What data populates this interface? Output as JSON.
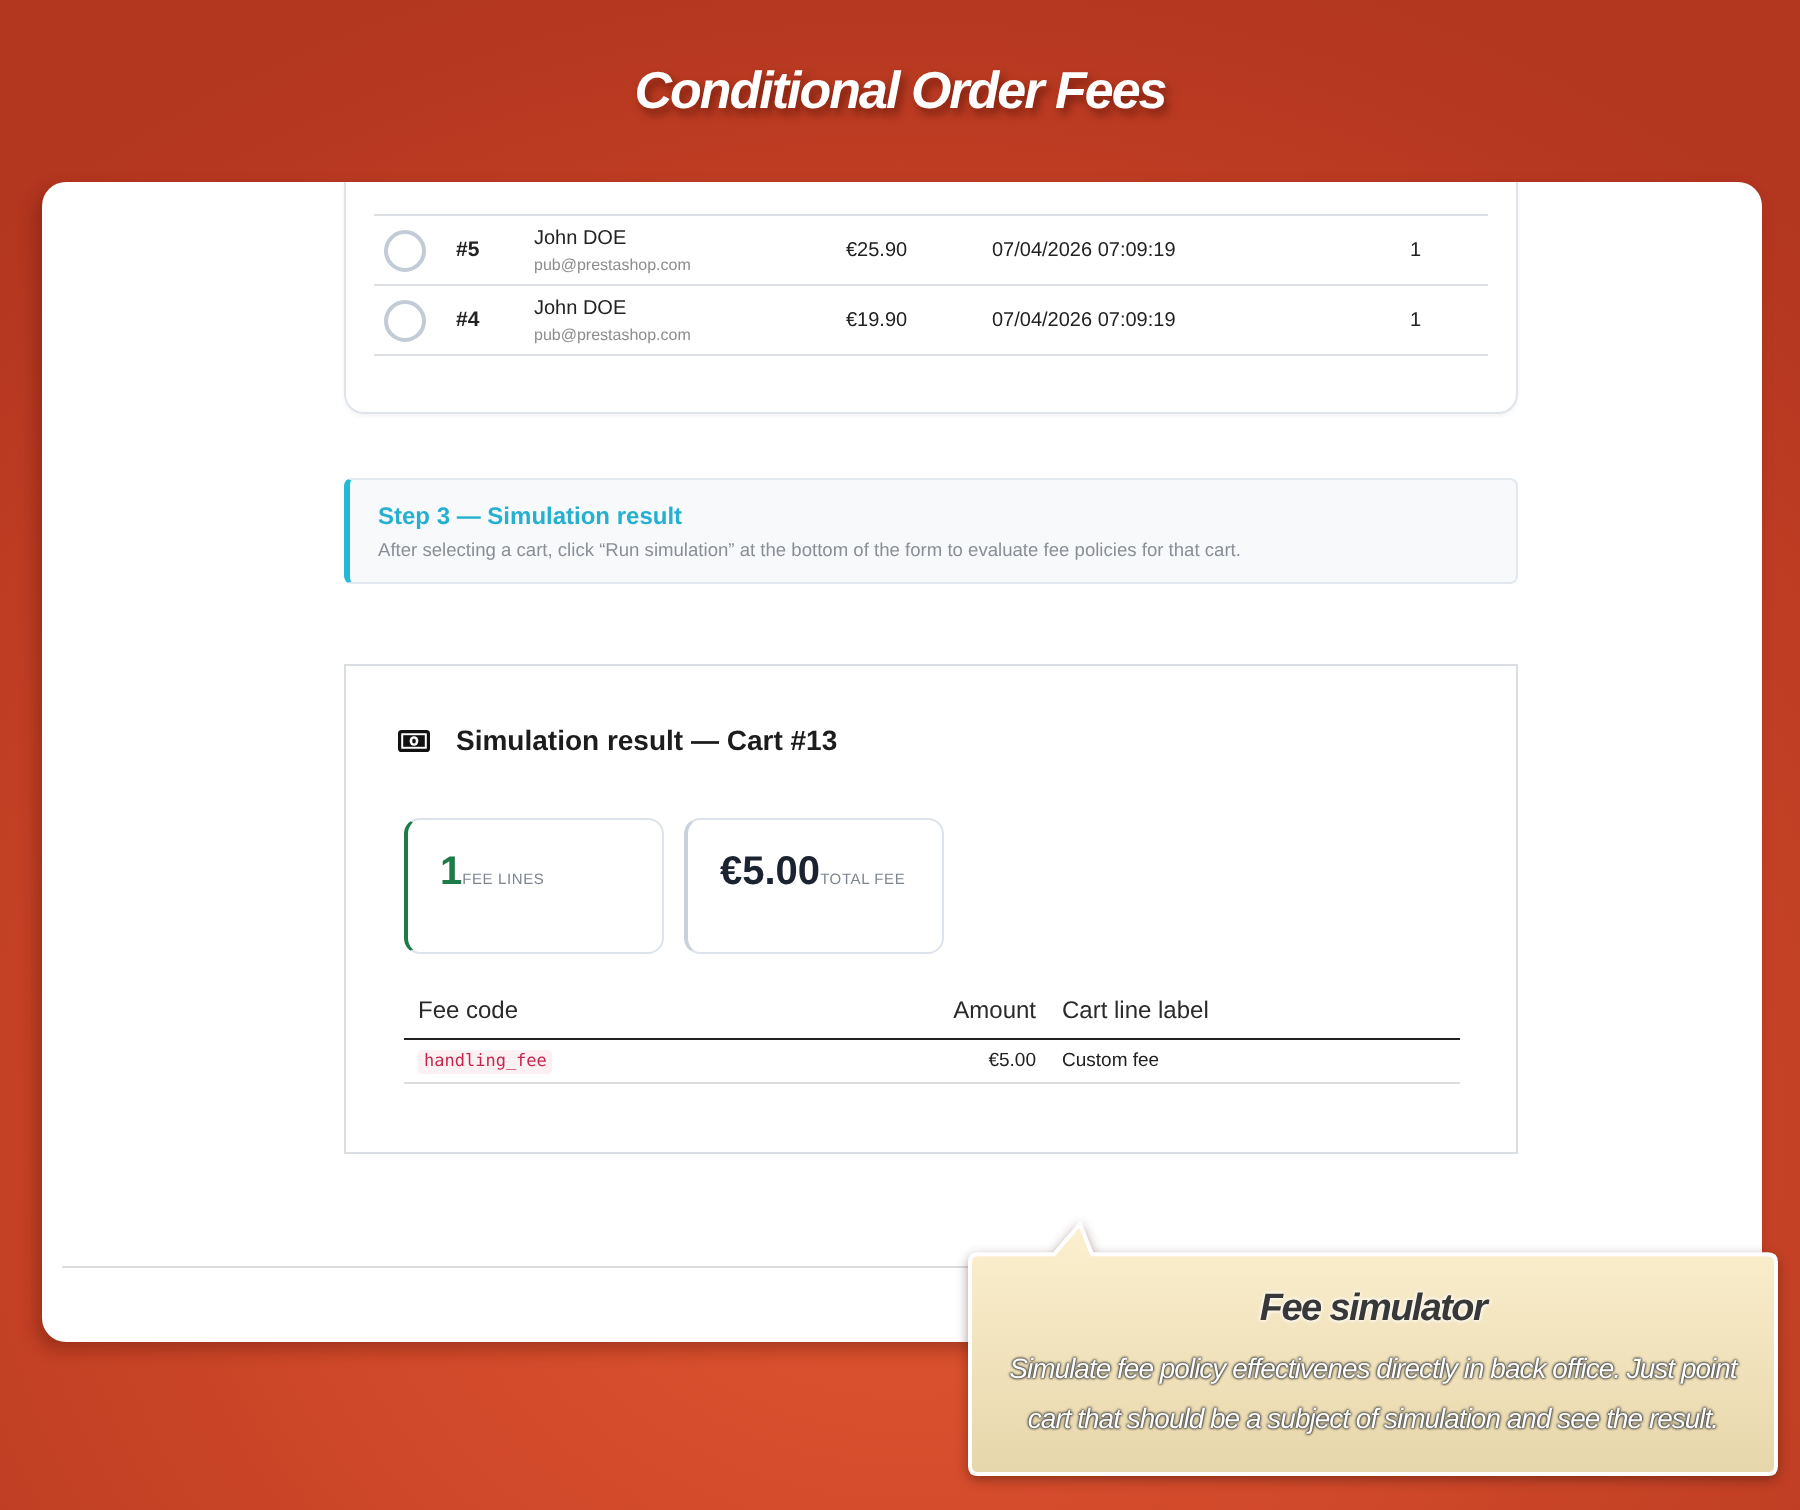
{
  "header": {
    "title": "Conditional Order Fees"
  },
  "carts_table": {
    "rows": [
      {
        "selected": false,
        "id": "#5",
        "customer": "John DOE",
        "email": "pub@prestashop.com",
        "amount": "€25.90",
        "date": "07/04/2026 07:09:19",
        "column_6": "1"
      },
      {
        "selected": false,
        "id": "#4",
        "customer": "John DOE",
        "email": "pub@prestashop.com",
        "amount": "€19.90",
        "date": "07/04/2026 07:09:19",
        "column_6": "1"
      }
    ]
  },
  "step": {
    "title": "Step 3 — Simulation result",
    "description": "After selecting a cart, click “Run simulation” at the bottom of the form to evaluate fee policies for that cart."
  },
  "result": {
    "title": "Simulation result — Cart #13",
    "stats": [
      {
        "kind": "success",
        "value": "1",
        "label": "FEE LINES"
      },
      {
        "kind": "neutral",
        "value": "€5.00",
        "label": "TOTAL FEE"
      }
    ],
    "table": {
      "columns": [
        "Fee code",
        "Amount",
        "Cart line label"
      ],
      "rows": [
        {
          "fee_code": "handling_fee",
          "amount": "€5.00",
          "cart_line_label": "Custom fee"
        }
      ]
    }
  },
  "callout": {
    "title": "Fee simulator",
    "text": "Simulate fee policy effectivenes directly in back office. Just point cart that should be a subject of simulation and see the result."
  }
}
